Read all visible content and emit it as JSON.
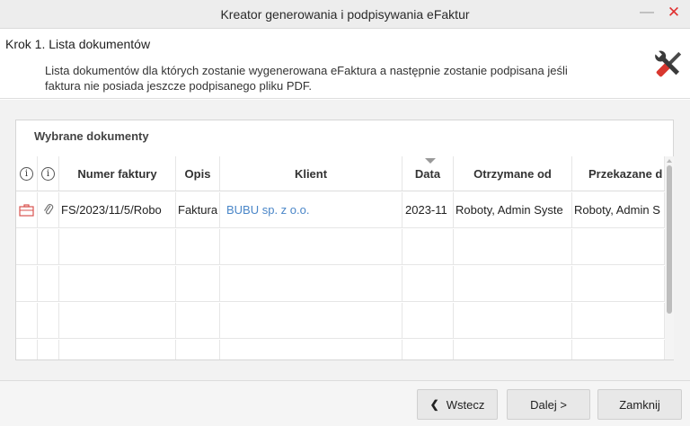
{
  "window": {
    "title": "Kreator generowania i podpisywania eFaktur",
    "minimize_glyph": "—",
    "close_glyph": "✕"
  },
  "header": {
    "step_title": "Krok 1. Lista dokumentów",
    "description": "Lista dokumentów dla których zostanie wygenerowana eFaktura a następnie zostanie podpisana jeśli faktura nie posiada jeszcze podpisanego pliku PDF.",
    "icon": "tools-icon"
  },
  "panel": {
    "title": "Wybrane dokumenty",
    "columns": {
      "info1": "i",
      "info2": "i",
      "numer": "Numer faktury",
      "opis": "Opis",
      "klient": "Klient",
      "data": "Data",
      "otrzymane": "Otrzymane od",
      "przekazane": "Przekazane d"
    },
    "rows": [
      {
        "icon1": "briefcase-icon",
        "icon2": "paperclip-icon",
        "numer": "FS/2023/11/5/Robo",
        "opis": "Faktura",
        "klient": "BUBU sp. z o.o.",
        "data": "2023-11",
        "otrzymane": "Roboty, Admin Syste",
        "przekazane": "Roboty, Admin S"
      }
    ],
    "sorted_column": "data",
    "colors": {
      "link": "#4a86c8",
      "briefcase": "#d9534f"
    }
  },
  "footer": {
    "back_label": "Wstecz",
    "back_glyph": "❮",
    "next_label": "Dalej >",
    "close_label": "Zamknij"
  }
}
